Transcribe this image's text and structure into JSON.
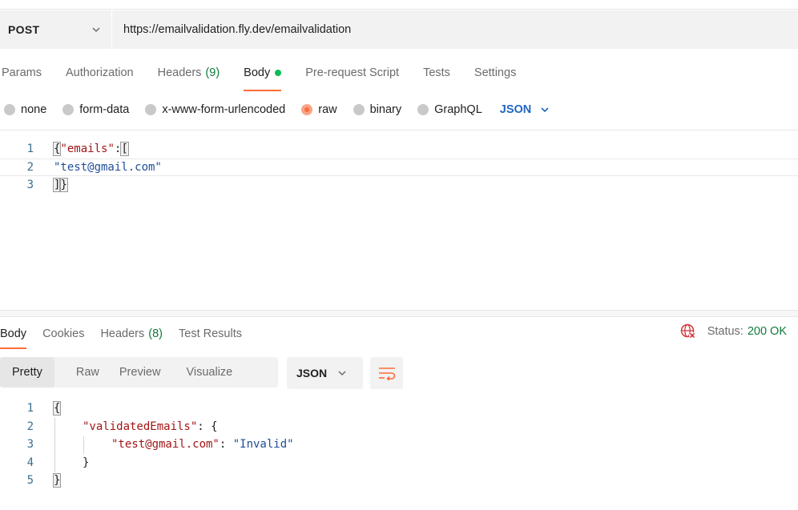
{
  "request": {
    "method": "POST",
    "url": "https://emailvalidation.fly.dev/emailvalidation"
  },
  "request_tabs": [
    {
      "label": "Params"
    },
    {
      "label": "Authorization"
    },
    {
      "label": "Headers",
      "count": "(9)"
    },
    {
      "label": "Body"
    },
    {
      "label": "Pre-request Script"
    },
    {
      "label": "Tests"
    },
    {
      "label": "Settings"
    }
  ],
  "body_types": [
    "none",
    "form-data",
    "x-www-form-urlencoded",
    "raw",
    "binary",
    "GraphQL"
  ],
  "body_type_selected": "raw",
  "body_format": "JSON",
  "request_body": {
    "line_numbers": [
      "1",
      "2",
      "3"
    ],
    "l1_open": "{",
    "l1_key": "\"emails\"",
    "l1_colon": ":",
    "l1_bracket": "[",
    "l2_value": "\"test@gmail.com\"",
    "l3_bracket": "]",
    "l3_close": "}"
  },
  "response_tabs": [
    {
      "label": "Body"
    },
    {
      "label": "Cookies"
    },
    {
      "label": "Headers",
      "count": "(8)"
    },
    {
      "label": "Test Results"
    }
  ],
  "status": {
    "label": "Status:",
    "value": "200 OK"
  },
  "format_tabs": [
    "Pretty",
    "Raw",
    "Preview",
    "Visualize"
  ],
  "response_format": "JSON",
  "response_body": {
    "line_numbers": [
      "1",
      "2",
      "3",
      "4",
      "5"
    ],
    "l1": "{",
    "l2_key": "\"validatedEmails\"",
    "l2_rest": ": {",
    "l3_key": "\"test@gmail.com\"",
    "l3_colon": ": ",
    "l3_value": "\"Invalid\"",
    "l4": "}",
    "l5": "}"
  },
  "colors": {
    "accent": "#ff6c37",
    "status_ok": "#0f7a3a",
    "json_link": "#1f66c3",
    "body_dot": "#0cbb52"
  },
  "icons": [
    "chevron-down-icon",
    "globe-error-icon",
    "word-wrap-icon"
  ]
}
